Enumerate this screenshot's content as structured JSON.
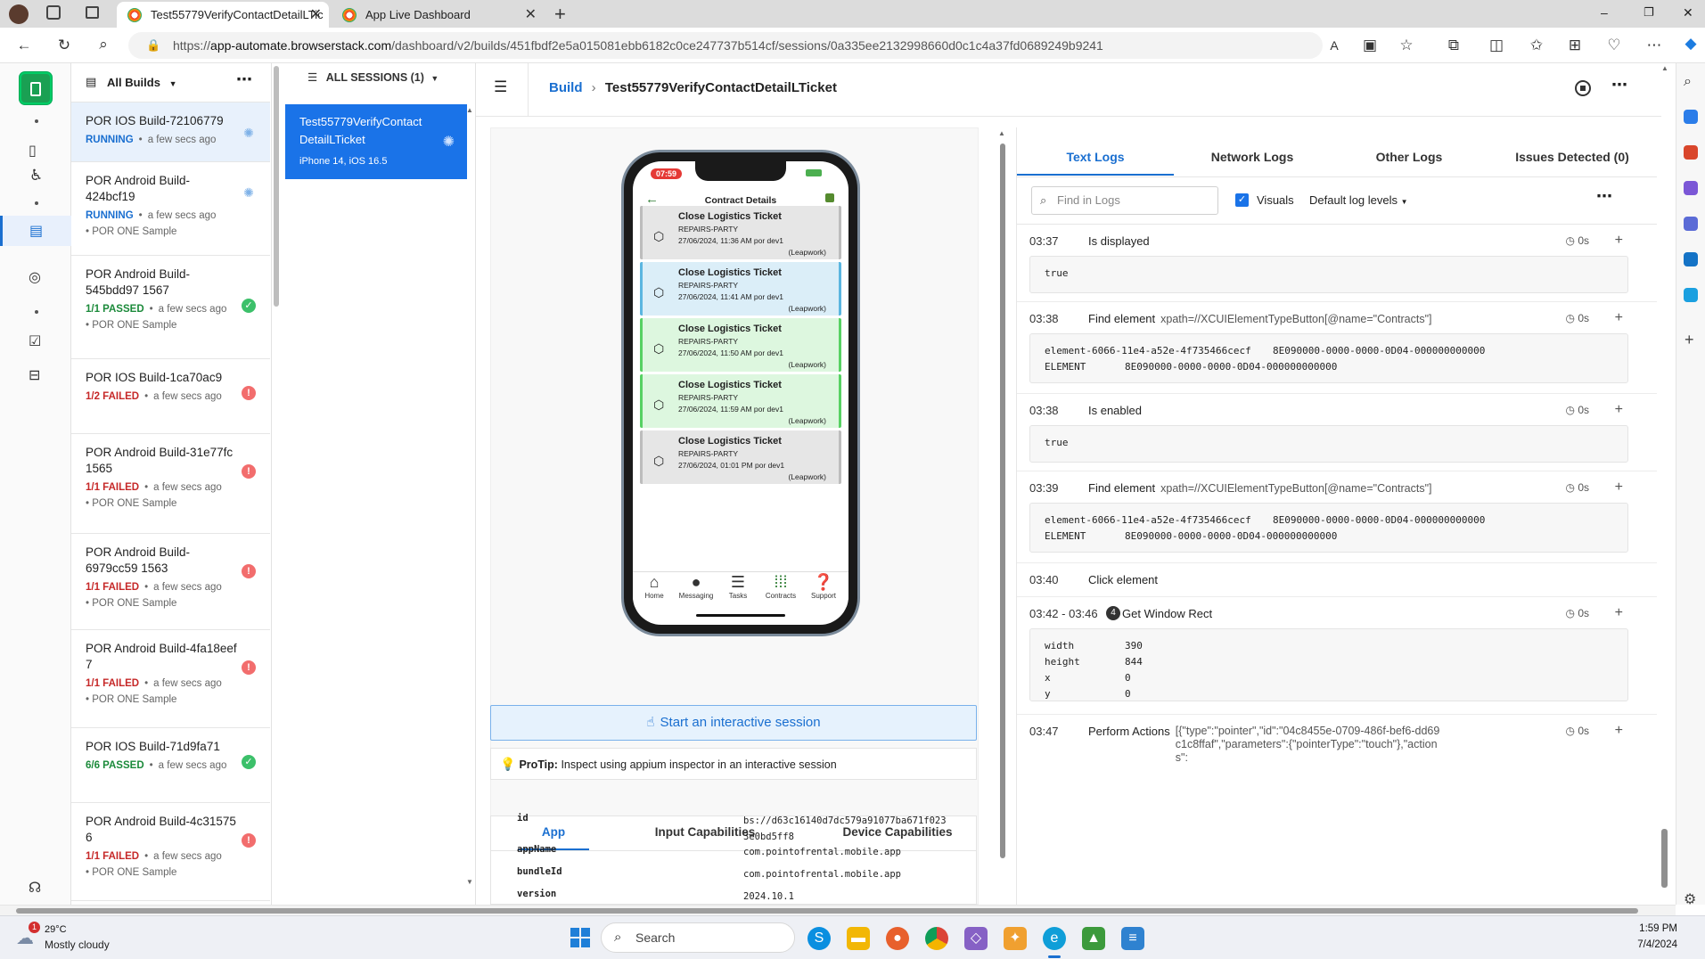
{
  "browser": {
    "tabs": [
      {
        "title": "Test55779VerifyContactDetailLTic",
        "active": true
      },
      {
        "title": "App Live Dashboard",
        "active": false
      }
    ],
    "url_prefix": "https://",
    "url_host": "app-automate.browserstack.com",
    "url_path": "/dashboard/v2/builds/451fbdf2e5a015081ebb6182c0ce247737b514cf/sessions/0a335ee2132998660d0c1c4a37fd0689249b9241",
    "window_controls": {
      "minimize": "–",
      "restore": "❐",
      "close": "✕"
    }
  },
  "builds_panel": {
    "header": "All Builds",
    "items": [
      {
        "title": "POR IOS Build-72106779",
        "status": "RUNNING",
        "status_type": "run",
        "time": "a few secs ago",
        "sample": "",
        "selected": true
      },
      {
        "title": "POR Android Build-424bcf19",
        "status": "RUNNING",
        "status_type": "run",
        "time": "a few secs ago",
        "sample": "POR ONE Sample",
        "selected": false
      },
      {
        "title": "POR Android Build-545bdd97 1567",
        "status": "1/1 PASSED",
        "status_type": "pass",
        "time": "a few secs ago",
        "sample": "POR ONE Sample",
        "selected": false
      },
      {
        "title": "POR IOS Build-1ca70ac9",
        "status": "1/2 FAILED",
        "status_type": "fail",
        "time": "a few secs ago",
        "sample": "",
        "selected": false
      },
      {
        "title": "POR Android Build-31e77fc 1565",
        "status": "1/1 FAILED",
        "status_type": "fail",
        "time": "a few secs ago",
        "sample": "POR ONE Sample",
        "selected": false
      },
      {
        "title": "POR Android Build-6979cc59 1563",
        "status": "1/1 FAILED",
        "status_type": "fail",
        "time": "a few secs ago",
        "sample": "POR ONE Sample",
        "selected": false
      },
      {
        "title": "POR Android Build-4fa18eef 7",
        "status": "1/1 FAILED",
        "status_type": "fail",
        "time": "a few secs ago",
        "sample": "POR ONE Sample",
        "selected": false
      },
      {
        "title": "POR IOS Build-71d9fa71",
        "status": "6/6 PASSED",
        "status_type": "pass",
        "time": "a few secs ago",
        "sample": "",
        "selected": false
      },
      {
        "title": "POR Android Build-4c31575 6",
        "status": "1/1 FAILED",
        "status_type": "fail",
        "time": "a few secs ago",
        "sample": "POR ONE Sample",
        "selected": false
      }
    ]
  },
  "sessions_panel": {
    "header": "ALL SESSIONS (1)",
    "session_name": "Test55779VerifyContactDetailLTicket",
    "device": "iPhone 14, iOS 16.5"
  },
  "header": {
    "breadcrumb_root": "Build",
    "breadcrumb_current": "Test55779VerifyContactDetailLTicket"
  },
  "device": {
    "time": "07:59",
    "screen_title": "Contract Details",
    "cards": [
      {
        "title": "Close Logistics Ticket",
        "party": "REPAIRS-PARTY",
        "date": "27/06/2024, 11:36 AM por dev1",
        "source": "(Leapwork)",
        "color": "#e6e6e6",
        "stripe": "#bdbdbd"
      },
      {
        "title": "Close Logistics Ticket",
        "party": "REPAIRS-PARTY",
        "date": "27/06/2024, 11:41 AM por dev1",
        "source": "(Leapwork)",
        "color": "#dbeef8",
        "stripe": "#5bb6e0"
      },
      {
        "title": "Close Logistics Ticket",
        "party": "REPAIRS-PARTY",
        "date": "27/06/2024, 11:50 AM por dev1",
        "source": "(Leapwork)",
        "color": "#ddf7df",
        "stripe": "#57d163"
      },
      {
        "title": "Close Logistics Ticket",
        "party": "REPAIRS-PARTY",
        "date": "27/06/2024, 11:59 AM por dev1",
        "source": "(Leapwork)",
        "color": "#ddf7df",
        "stripe": "#57d163"
      },
      {
        "title": "Close Logistics Ticket",
        "party": "REPAIRS-PARTY",
        "date": "27/06/2024, 01:01 PM por dev1",
        "source": "(Leapwork)",
        "color": "#e6e6e6",
        "stripe": "#bdbdbd"
      }
    ],
    "nav": [
      "Home",
      "Messaging",
      "Tasks",
      "Contracts",
      "Support"
    ],
    "interactive_button": "Start an interactive session",
    "protip_label": "ProTip:",
    "protip_text": "Inspect using appium inspector in an interactive session"
  },
  "caps": {
    "tabs": [
      "App",
      "Input Capabilities",
      "Device Capabilities"
    ],
    "rows": [
      {
        "key": "id",
        "value": "bs://d63c16140d7dc579a91077ba671f0233e0bd5ff8"
      },
      {
        "key": "appName",
        "value": "com.pointofrental.mobile.app"
      },
      {
        "key": "bundleId",
        "value": "com.pointofrental.mobile.app"
      },
      {
        "key": "version",
        "value": "2024.10.1"
      }
    ]
  },
  "logs": {
    "tabs": [
      "Text Logs",
      "Network Logs",
      "Other Logs",
      "Issues Detected (0)"
    ],
    "search_placeholder": "Find in Logs",
    "visuals_label": "Visuals",
    "levels_label": "Default log levels",
    "entries": [
      {
        "time": "03:37",
        "action": "Is displayed",
        "selector": "",
        "duration": "0s",
        "box": [
          [
            "true",
            ""
          ]
        ]
      },
      {
        "time": "03:38",
        "action": "Find element",
        "selector": "xpath=//XCUIElementTypeButton[@name=\"Contracts\"]",
        "duration": "0s",
        "box": [
          [
            "element-6066-11e4-a52e-4f735466cecf",
            "8E090000-0000-0000-0D04-000000000000"
          ],
          [
            "ELEMENT",
            "8E090000-0000-0000-0D04-000000000000"
          ]
        ]
      },
      {
        "time": "03:38",
        "action": "Is enabled",
        "selector": "",
        "duration": "0s",
        "box": [
          [
            "true",
            ""
          ]
        ]
      },
      {
        "time": "03:39",
        "action": "Find element",
        "selector": "xpath=//XCUIElementTypeButton[@name=\"Contracts\"]",
        "duration": "0s",
        "box": [
          [
            "element-6066-11e4-a52e-4f735466cecf",
            "8E090000-0000-0000-0D04-000000000000"
          ],
          [
            "ELEMENT",
            "8E090000-0000-0000-0D04-000000000000"
          ]
        ]
      },
      {
        "time": "03:40",
        "action": "Click element",
        "selector": "",
        "duration": "",
        "box": []
      },
      {
        "time": "03:42 - 03:46",
        "count": "4",
        "action": "Get Window Rect",
        "selector": "",
        "duration": "0s",
        "box": [
          [
            "width",
            "390"
          ],
          [
            "height",
            "844"
          ],
          [
            "x",
            "0"
          ],
          [
            "y",
            "0"
          ]
        ]
      },
      {
        "time": "03:47",
        "action": "Perform Actions",
        "selector": "[{\"type\":\"pointer\",\"id\":\"04c8455e-0709-486f-bef6-dd69c1c8ffaf\",\"parameters\":{\"pointerType\":\"touch\"},\"actions\":",
        "duration": "0s",
        "box": []
      }
    ]
  },
  "taskbar": {
    "weather_temp": "29°C",
    "weather_desc": "Mostly cloudy",
    "weather_badge": "1",
    "search_placeholder": "Search",
    "time": "1:59 PM",
    "date": "7/4/2024"
  }
}
